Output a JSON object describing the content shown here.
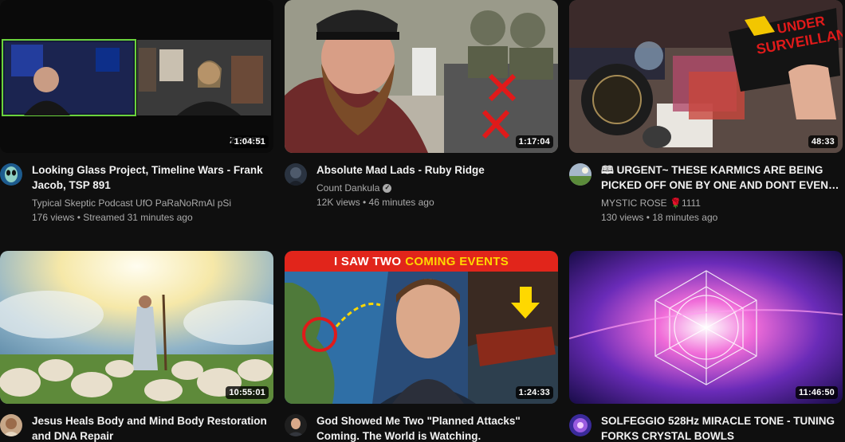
{
  "videos": [
    {
      "title": "Looking Glass Project, Timeline Wars - Frank Jacob, TSP 891",
      "channel": "Typical Skeptic Podcast UfO PaRaNoRmAl pSi",
      "stats": "176 views • Streamed 31 minutes ago",
      "duration": "1:04:51",
      "overlay_text": "zoom"
    },
    {
      "title": "Absolute Mad Lads - Ruby Ridge",
      "channel": "Count Dankula",
      "stats": "12K views • 46 minutes ago",
      "duration": "1:17:04",
      "verified": true
    },
    {
      "title": "🕮 URGENT~ THESE KARMICS ARE BEING PICKED OFF ONE BY ONE AND DONT EVEN…",
      "channel": "MYSTIC ROSE 🌹1111",
      "stats": "130 views • 18 minutes ago",
      "duration": "48:33",
      "overlay_text": "UNDER SURVEILLANCE"
    },
    {
      "title": "Jesus Heals Body and Mind Body Restoration and DNA Repair",
      "channel": "",
      "stats": "",
      "duration": "10:55:01"
    },
    {
      "title": "God Showed Me Two \"Planned Attacks\" Coming. The World is Watching.",
      "channel": "",
      "stats": "",
      "duration": "1:24:33",
      "banner_white": "I SAW TWO",
      "banner_yellow": "COMING EVENTS"
    },
    {
      "title": "SOLFEGGIO 528Hz MIRACLE TONE - TUNING FORKS CRYSTAL BOWLS",
      "channel": "",
      "stats": "",
      "duration": "11:46:50"
    }
  ],
  "icons": {
    "verified": "verified-check-icon"
  },
  "colors": {
    "background": "#0f0f0f",
    "text_primary": "#f1f1f1",
    "text_secondary": "#aaaaaa",
    "banner_red": "#e1251b",
    "banner_yellow": "#ffd800"
  }
}
